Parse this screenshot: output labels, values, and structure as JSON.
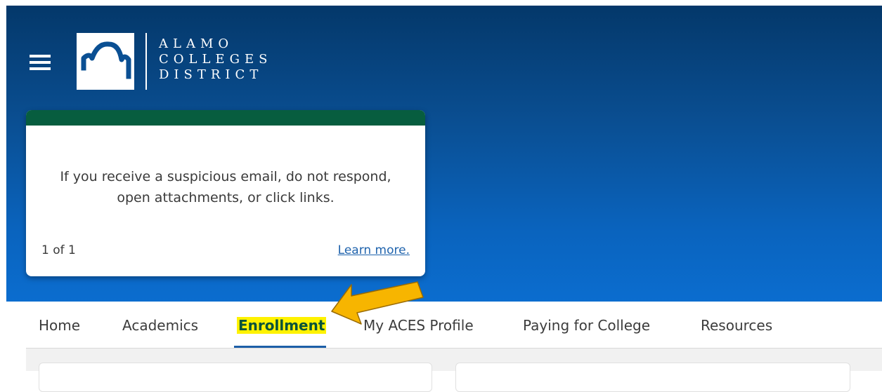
{
  "logo": {
    "line1": "ALAMO",
    "line2": "COLLEGES",
    "line3": "DISTRICT"
  },
  "alert": {
    "message_line1": "If you receive a suspicious email, do not respond,",
    "message_line2": "open attachments, or click links.",
    "counter": "1 of 1",
    "link_label": "Learn more."
  },
  "nav": {
    "items": [
      {
        "label": "Home"
      },
      {
        "label": "Academics"
      },
      {
        "label": "Enrollment"
      },
      {
        "label": "My ACES Profile"
      },
      {
        "label": "Paying for College"
      },
      {
        "label": "Resources"
      }
    ],
    "active": "Enrollment"
  },
  "colors": {
    "header_top": "#04386a",
    "header_bottom": "#0b6dcf",
    "alert_bar": "#075d3f",
    "highlight": "#fff200",
    "arrow": "#f7b500",
    "link": "#1f63ad"
  }
}
